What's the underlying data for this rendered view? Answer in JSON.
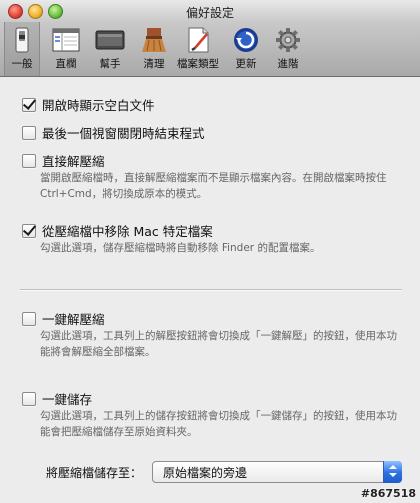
{
  "window": {
    "title": "偏好設定"
  },
  "toolbar": {
    "items": [
      {
        "label": "一般",
        "icon": "switch-icon"
      },
      {
        "label": "直欄",
        "icon": "columns-icon"
      },
      {
        "label": "幫手",
        "icon": "helper-icon"
      },
      {
        "label": "清理",
        "icon": "broom-icon"
      },
      {
        "label": "檔案類型",
        "icon": "file-types-icon"
      },
      {
        "label": "更新",
        "icon": "update-icon"
      },
      {
        "label": "進階",
        "icon": "gear-icon"
      }
    ],
    "selected_index": 0
  },
  "options": [
    {
      "label": "開啟時顯示空白文件",
      "checked": true,
      "description": ""
    },
    {
      "label": "最後一個視窗關閉時結束程式",
      "checked": false,
      "description": ""
    },
    {
      "label": "直接解壓縮",
      "checked": false,
      "description": "當開啟壓縮檔時，直接解壓縮檔案而不是顯示檔案內容。在開啟檔案時按住 Ctrl+Cmd，將切換成原本的模式。"
    },
    {
      "label": "從壓縮檔中移除 Mac 特定檔案",
      "checked": true,
      "description": "勾選此選項，儲存壓縮檔時將自動移除 Finder 的配置檔案。"
    },
    {
      "label": "一鍵解壓縮",
      "checked": false,
      "description": "勾選此選項，工具列上的解壓按鈕將會切換成「一鍵解壓」的按鈕，使用本功能將會解壓縮全部檔案。"
    },
    {
      "label": "一鍵儲存",
      "checked": false,
      "description": "勾選此選項，工具列上的儲存按鈕將會切換成「一鍵儲存」的按鈕，使用本功能會把壓縮檔儲存至原始資料夾。"
    }
  ],
  "save_location": {
    "label": "將壓縮檔儲存至：",
    "value": "原始檔案的旁邊"
  },
  "watermark": "#867518",
  "colors": {
    "accent": "#2b6fe0"
  }
}
